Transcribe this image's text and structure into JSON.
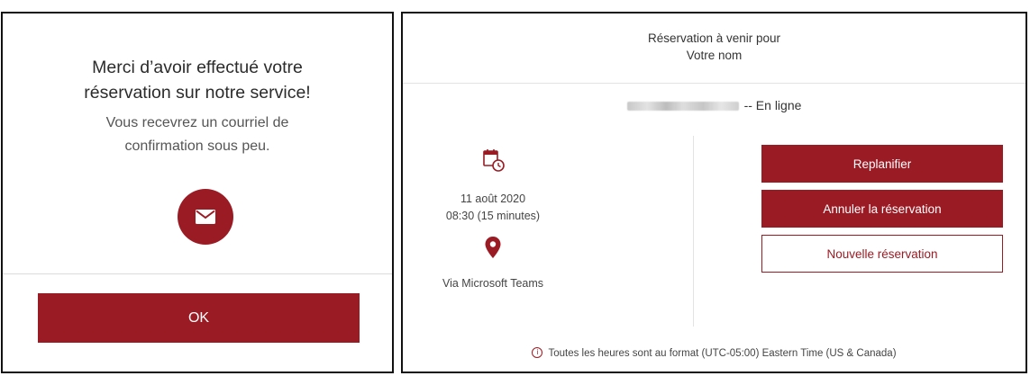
{
  "confirmation": {
    "title_line1": "Merci d’avoir effectué votre",
    "title_line2": "réservation sur notre service!",
    "subtitle_line1": "Vous recevrez un courriel de",
    "subtitle_line2": "confirmation sous peu.",
    "icon": "envelope-icon",
    "ok_label": "OK"
  },
  "booking": {
    "header_line1": "Réservation à venir pour",
    "header_line2": "Votre nom",
    "service_suffix": "-- En ligne",
    "date": "11 août 2020",
    "time": "08:30 (15 minutes)",
    "location": "Via Microsoft Teams",
    "icons": {
      "calendar": "calendar-clock-icon",
      "location": "map-pin-icon",
      "info": "info-icon"
    },
    "buttons": {
      "replan": "Replanifier",
      "cancel": "Annuler la réservation",
      "new": "Nouvelle réservation"
    },
    "timezone_note": "Toutes les heures sont au format (UTC-05:00) Eastern Time (US & Canada)"
  },
  "colors": {
    "accent": "#9b1b24",
    "text": "#333333",
    "border": "#111111"
  }
}
